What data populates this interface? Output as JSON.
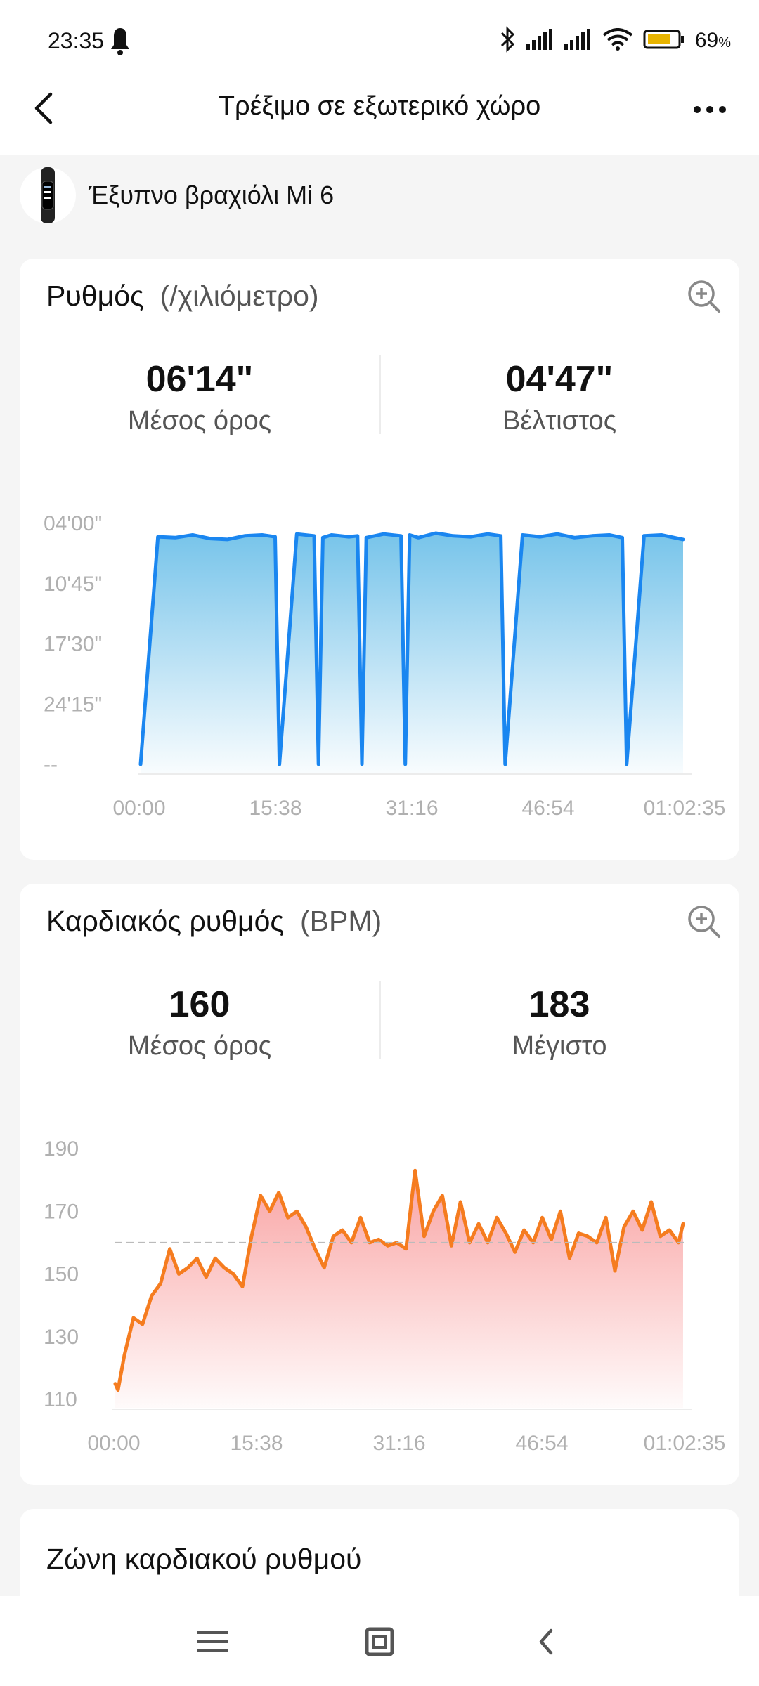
{
  "status": {
    "time": "23:35",
    "battery": "69",
    "battery_unit": "%"
  },
  "header": {
    "title": "Τρέξιμο σε εξωτερικό χώρο"
  },
  "device": {
    "name": "Έξυπνο βραχιόλι Mi 6"
  },
  "pace_card": {
    "title": "Ρυθμός",
    "unit": "(/χιλιόμετρο)",
    "avg_value": "06'14\"",
    "avg_label": "Μέσος όρος",
    "best_value": "04'47\"",
    "best_label": "Βέλτιστος"
  },
  "hr_card": {
    "title": "Καρδιακός ρυθμός",
    "unit": "(BPM)",
    "avg_value": "160",
    "avg_label": "Μέσος όρος",
    "max_value": "183",
    "max_label": "Μέγιστο"
  },
  "zone_card": {
    "title": "Ζώνη καρδιακού ρυθμού"
  },
  "colors": {
    "pace_line": "#1a86f0",
    "pace_fill_top": "#77c4ea",
    "hr_line": "#f57c1f",
    "hr_fill_top": "#f9a3a3"
  },
  "icons": {
    "back": "back-arrow-icon",
    "more": "more-dots-icon",
    "zoom": "zoom-in-icon",
    "nav_menu": "menu-icon",
    "nav_home": "home-square-icon",
    "nav_back": "chevron-left-icon"
  },
  "chart_data": [
    {
      "type": "area",
      "title": "Ρυθμός",
      "y_unit": "min/km",
      "y_ticks": [
        "04'00\"",
        "10'45\"",
        "17'30\"",
        "24'15\"",
        "--"
      ],
      "x_ticks": [
        "00:00",
        "15:38",
        "31:16",
        "46:54",
        "01:02:35"
      ],
      "y_inverted": true,
      "x_range_min": [
        0,
        62.58
      ],
      "y_range_min_per_km": [
        4.0,
        31.0
      ],
      "series": [
        {
          "x_min": [
            0,
            2,
            4,
            6,
            8,
            10,
            12,
            14,
            15.5,
            16,
            18,
            20,
            20.5,
            21,
            22,
            24,
            25,
            25.5,
            26,
            28,
            30,
            30.5,
            31,
            32,
            34,
            36,
            38,
            40,
            41.5,
            42,
            44,
            46,
            48,
            50,
            52,
            54,
            55.5,
            56,
            58,
            60,
            62.5
          ],
          "y_min_per_km": [
            31,
            5.5,
            5.6,
            5.3,
            5.7,
            5.8,
            5.4,
            5.3,
            5.5,
            31,
            5.2,
            5.4,
            31,
            5.6,
            5.3,
            5.5,
            5.4,
            31,
            5.6,
            5.2,
            5.4,
            31,
            5.3,
            5.6,
            5.1,
            5.4,
            5.5,
            5.2,
            5.4,
            31,
            5.3,
            5.5,
            5.2,
            5.6,
            5.4,
            5.3,
            5.6,
            31,
            5.4,
            5.3,
            5.8
          ]
        }
      ]
    },
    {
      "type": "area",
      "title": "Καρδιακός ρυθμός",
      "y_unit": "BPM",
      "y_ticks": [
        "190",
        "170",
        "150",
        "130",
        "110"
      ],
      "x_ticks": [
        "00:00",
        "15:38",
        "31:16",
        "46:54",
        "01:02:35"
      ],
      "x_range_min": [
        0,
        62.58
      ],
      "y_range": [
        110,
        190
      ],
      "average_line": 160,
      "series": [
        {
          "x_min": [
            0,
            0.3,
            1,
            2,
            3,
            4,
            5,
            6,
            7,
            8,
            9,
            10,
            11,
            12,
            13,
            14,
            15,
            16,
            17,
            18,
            19,
            20,
            21,
            22,
            23,
            24,
            25,
            26,
            27,
            28,
            29,
            30,
            31,
            32,
            33,
            34,
            35,
            36,
            37,
            38,
            39,
            40,
            41,
            42,
            43,
            44,
            45,
            46,
            47,
            48,
            49,
            50,
            51,
            52,
            53,
            54,
            55,
            56,
            57,
            58,
            59,
            60,
            61,
            62,
            62.5
          ],
          "y": [
            115,
            113,
            124,
            136,
            134,
            143,
            147,
            158,
            150,
            152,
            155,
            149,
            155,
            152,
            150,
            146,
            162,
            175,
            170,
            176,
            168,
            170,
            165,
            158,
            152,
            162,
            164,
            160,
            168,
            160,
            161,
            159,
            160,
            158,
            183,
            162,
            170,
            175,
            159,
            173,
            160,
            166,
            160,
            168,
            163,
            157,
            164,
            160,
            168,
            161,
            170,
            155,
            163,
            162,
            160,
            168,
            151,
            165,
            170,
            164,
            173,
            162,
            164,
            160,
            166
          ]
        }
      ]
    }
  ]
}
